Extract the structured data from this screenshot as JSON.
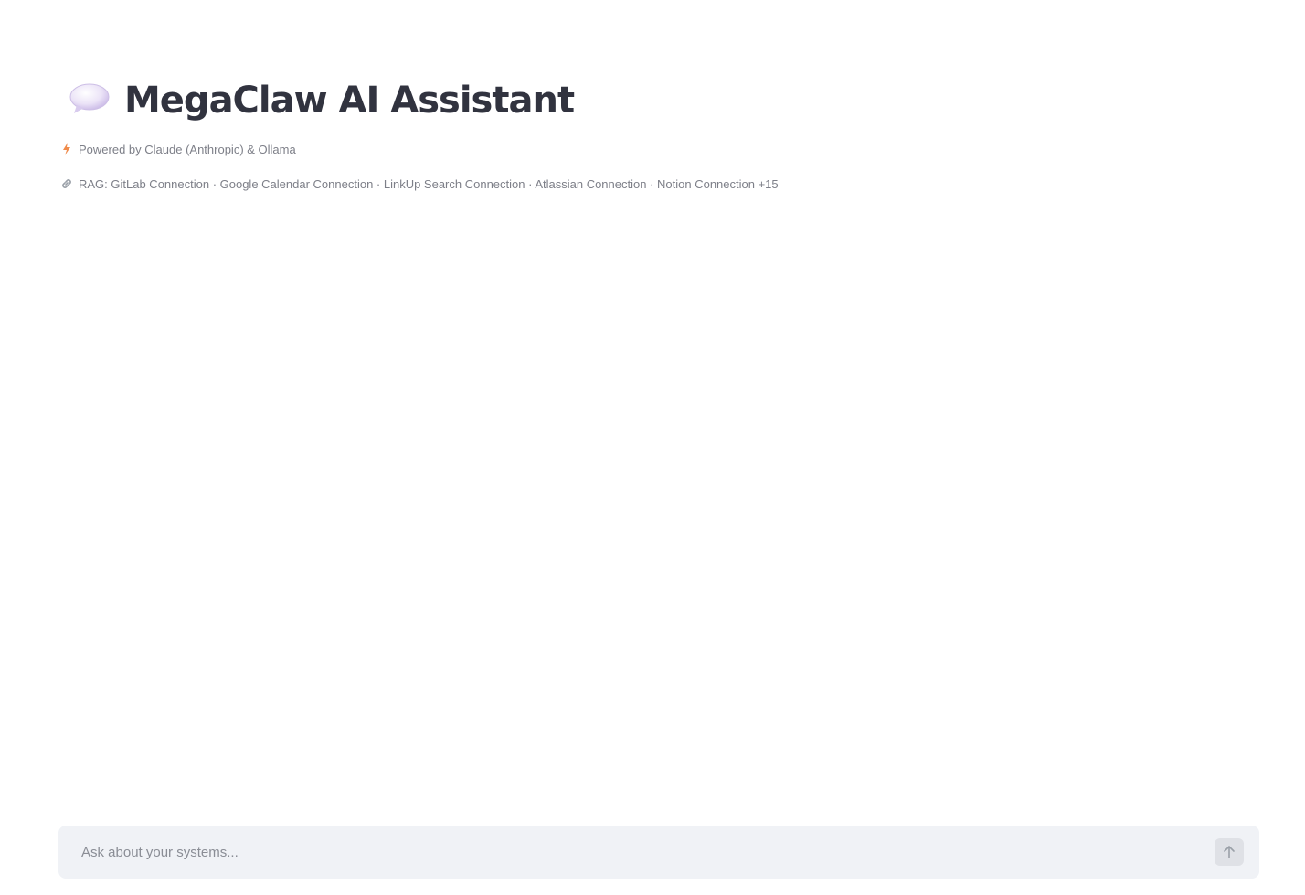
{
  "header": {
    "title": "MegaClaw AI Assistant",
    "title_icon": "speech-balloon-icon",
    "powered_by_icon": "lightning-icon",
    "powered_by": "Powered by Claude (Anthropic) & Ollama",
    "rag_icon": "link-icon",
    "rag_connections": "RAG: GitLab Connection · Google Calendar Connection · LinkUp Search Connection · Atlassian Connection · Notion Connection +15"
  },
  "chat": {
    "input_placeholder": "Ask about your systems...",
    "input_value": "",
    "send_icon": "arrow-up-icon"
  },
  "colors": {
    "title": "#31333f",
    "caption": "#7d7f88",
    "input_background": "#f0f2f6",
    "lightning": "#f08b4b"
  }
}
